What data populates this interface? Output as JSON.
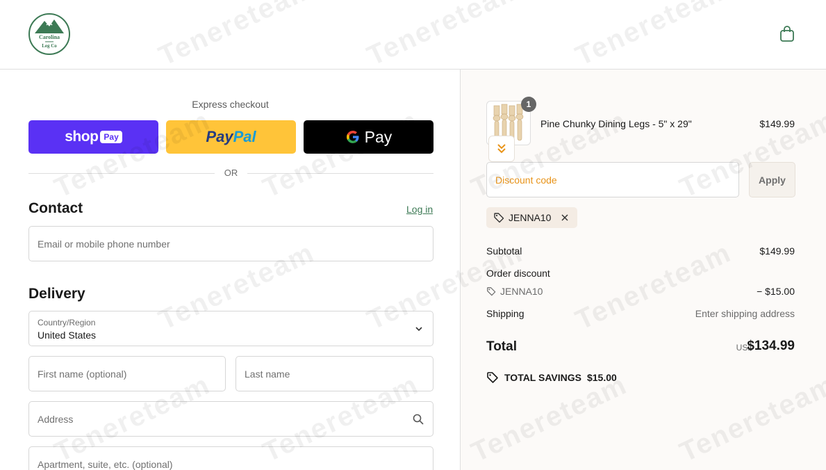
{
  "brand": {
    "logo_line1": "Carolina",
    "logo_line2": "Leg Co",
    "logo_color": "#3d7a55"
  },
  "header": {
    "cart_icon": "shopping-bag-icon"
  },
  "express": {
    "title": "Express checkout",
    "shop_pay": {
      "word": "shop",
      "pill": "Pay",
      "color": "#5a31f4"
    },
    "paypal": {
      "part1": "Pay",
      "part2": "Pal",
      "color": "#ffc439"
    },
    "gpay": {
      "letter": "G",
      "word": "Pay",
      "color": "#000000"
    },
    "divider": "OR"
  },
  "contact": {
    "title": "Contact",
    "login_link": "Log in",
    "email_placeholder": "Email or mobile phone number"
  },
  "delivery": {
    "title": "Delivery",
    "country_label": "Country/Region",
    "country_value": "United States",
    "first_name_placeholder": "First name (optional)",
    "last_name_placeholder": "Last name",
    "address_placeholder": "Address",
    "apartment_placeholder": "Apartment, suite, etc. (optional)"
  },
  "order": {
    "product": {
      "name": "Pine Chunky Dining Legs - 5\" x 29\"",
      "price": "$149.99",
      "quantity": "1"
    },
    "discount": {
      "placeholder": "Discount code",
      "apply_label": "Apply",
      "applied_code": "JENNA10"
    },
    "summary": {
      "subtotal_label": "Subtotal",
      "subtotal_value": "$149.99",
      "order_discount_label": "Order discount",
      "discount_code": "JENNA10",
      "discount_value": "− $15.00",
      "shipping_label": "Shipping",
      "shipping_value": "Enter shipping address",
      "total_label": "Total",
      "total_currency": "USD",
      "total_value": "$134.99",
      "savings_label": "TOTAL SAVINGS",
      "savings_value": "$15.00"
    }
  },
  "watermark_text": "Tenereteam"
}
